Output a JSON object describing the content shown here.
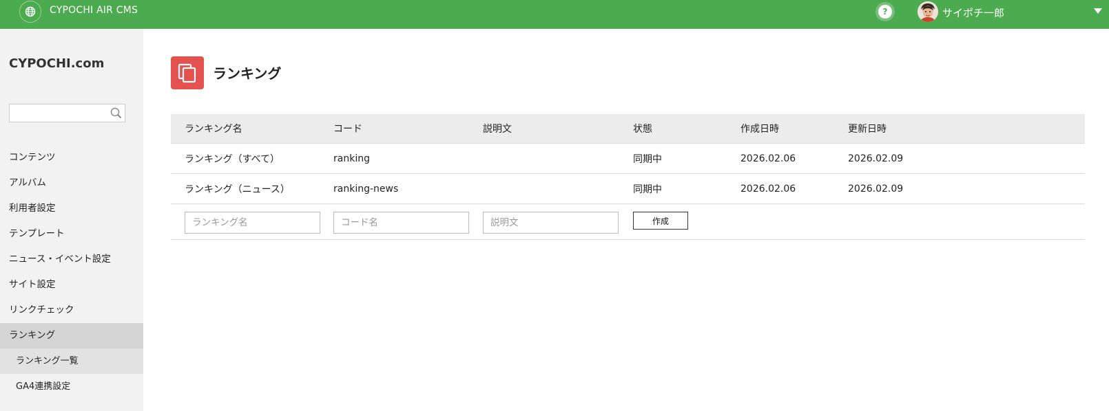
{
  "app": {
    "title": "CYPOCHI AIR CMS"
  },
  "header": {
    "help_label": "?",
    "username": "サイポチ一郎"
  },
  "sidebar": {
    "site_name": "CYPOCHI.com",
    "search": {
      "value": "",
      "placeholder": ""
    },
    "items": [
      {
        "label": "コンテンツ"
      },
      {
        "label": "アルバム"
      },
      {
        "label": "利用者設定"
      },
      {
        "label": "テンプレート"
      },
      {
        "label": "ニュース・イベント設定"
      },
      {
        "label": "サイト設定"
      },
      {
        "label": "リンクチェック"
      },
      {
        "label": "ランキング",
        "active": true
      }
    ],
    "sub_items": [
      {
        "label": "ランキング一覧",
        "active": true
      },
      {
        "label": "GA4連携設定"
      }
    ]
  },
  "page": {
    "title": "ランキング",
    "icon": "copy-icon",
    "accent": "#e4524f"
  },
  "table": {
    "headers": [
      "ランキング名",
      "コード",
      "説明文",
      "状態",
      "作成日時",
      "更新日時"
    ],
    "rows": [
      [
        "ランキング（すべて）",
        "ranking",
        "",
        "同期中",
        "2026.02.06",
        "2026.02.09"
      ],
      [
        "ランキング（ニュース）",
        "ranking-news",
        "",
        "同期中",
        "2026.02.06",
        "2026.02.09"
      ]
    ],
    "form": {
      "name_placeholder": "ランキング名",
      "code_placeholder": "コード名",
      "desc_placeholder": "説明文",
      "create_label": "作成"
    }
  },
  "colors": {
    "topbar": "#4caa4f",
    "sidebar": "#f2f2f2"
  }
}
